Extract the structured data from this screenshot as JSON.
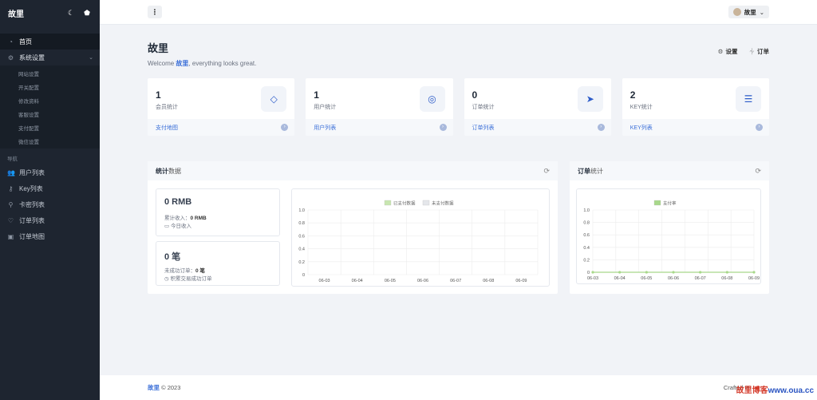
{
  "sidebar": {
    "brand": "故里",
    "theme_icon": "moon-icon",
    "pin_icon": "pin-icon",
    "items_top": [
      {
        "label": "首页",
        "icon": "dashboard-icon",
        "active": true
      },
      {
        "label": "系统设置",
        "icon": "settings-icon",
        "open": true
      }
    ],
    "sub_items": [
      "网站设置",
      "开关配置",
      "修改资料",
      "客服设置",
      "支付配置",
      "微信设置"
    ],
    "heading": "导航",
    "items_nav": [
      {
        "label": "用户列表",
        "icon": "users-icon"
      },
      {
        "label": "Key列表",
        "icon": "key-icon"
      },
      {
        "label": "卡密列表",
        "icon": "card-icon"
      },
      {
        "label": "订单列表",
        "icon": "heart-icon"
      },
      {
        "label": "订单地图",
        "icon": "map-icon"
      }
    ]
  },
  "topbar": {
    "menu_icon": "more-vertical-icon",
    "username": "故里"
  },
  "hero": {
    "title": "故里",
    "welcome_prefix": "Welcome ",
    "welcome_name": "故里",
    "welcome_suffix": ", everything looks great.",
    "settings_label": "设置",
    "orders_label": "订单"
  },
  "cards": [
    {
      "value": "1",
      "label": "会员统计",
      "link": "支付地图",
      "icon": "diamond-icon"
    },
    {
      "value": "1",
      "label": "用户统计",
      "link": "用户列表",
      "icon": "user-circle-icon"
    },
    {
      "value": "0",
      "label": "订单统计",
      "link": "订单列表",
      "icon": "send-icon"
    },
    {
      "value": "2",
      "label": "KEY统计",
      "link": "KEY列表",
      "icon": "list-icon"
    }
  ],
  "stats_panel": {
    "title_bold": "统计",
    "title_rest": "数据",
    "rmb_big": "0 RMB",
    "rmb_line1_label": "累计收入：",
    "rmb_line1_value": "0 RMB",
    "rmb_line2": "今日收入",
    "orders_big": "0 笔",
    "orders_line1_label": "未成功订单：",
    "orders_line1_value": "0 笔",
    "orders_line2": "积累交易成功订单"
  },
  "orders_panel": {
    "title_bold": "订单",
    "title_rest": "统计"
  },
  "chart_data": [
    {
      "type": "bar",
      "categories": [
        "06-03",
        "06-04",
        "06-05",
        "06-06",
        "06-07",
        "06-08",
        "06-09"
      ],
      "series": [
        {
          "name": "已支付数据",
          "values": [
            0,
            0,
            0,
            0,
            0,
            0,
            0
          ],
          "color": "#c8e6b0"
        },
        {
          "name": "未支付数据",
          "values": [
            0,
            0,
            0,
            0,
            0,
            0,
            0
          ],
          "color": "#e5e7eb"
        }
      ],
      "yticks": [
        "0",
        "0.2",
        "0.4",
        "0.6",
        "0.8",
        "1.0"
      ],
      "ylim": [
        0,
        1.0
      ],
      "grid": true,
      "legend": "top"
    },
    {
      "type": "line",
      "categories": [
        "06-03",
        "06-04",
        "06-05",
        "06-06",
        "06-07",
        "06-08",
        "06-09"
      ],
      "series": [
        {
          "name": "支付率",
          "values": [
            0,
            0,
            0,
            0,
            0,
            0,
            0
          ],
          "color": "#a8d88a"
        }
      ],
      "yticks": [
        "0",
        "0.2",
        "0.4",
        "0.6",
        "0.8",
        "1.0"
      ],
      "ylim": [
        0,
        1.0
      ],
      "grid": true,
      "legend": "top"
    }
  ],
  "footer": {
    "brand": "故里",
    "copyright": " © 2023",
    "crafted": "Crafted w",
    "watermark_red": "故里博客",
    "watermark_blue": "www.oua.cc"
  }
}
